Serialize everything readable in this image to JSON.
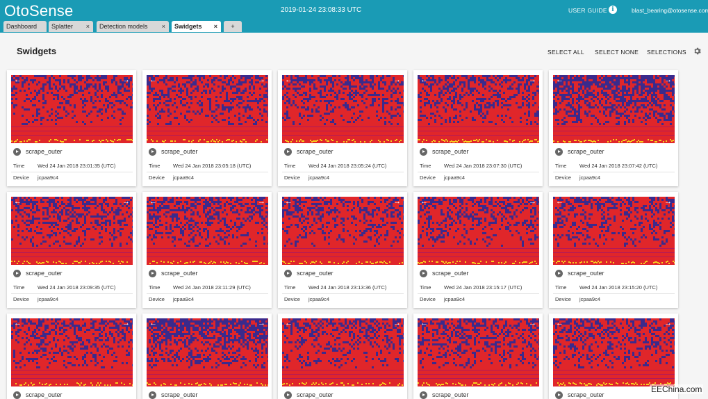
{
  "app": {
    "brand": "OtoSense",
    "clock": "2019-01-24 23:08:33 UTC",
    "user_guide": "USER GUIDE",
    "info_glyph": "i",
    "user_email": "blast_bearing@otosense.com"
  },
  "tabs": [
    {
      "label": "Dashboard",
      "closable": false
    },
    {
      "label": "Splatter",
      "closable": true
    },
    {
      "label": "Detection models",
      "closable": true
    },
    {
      "label": "Swidgets",
      "closable": true,
      "active": true
    },
    {
      "label": "+",
      "closable": false
    }
  ],
  "tab_close_glyph": "×",
  "toolbar": {
    "title": "Swidgets",
    "select_all": "SELECT ALL",
    "select_none": "SELECT NONE",
    "selections": "SELECTIONS",
    "settings_icon": "gear-icon"
  },
  "card_labels": {
    "time": "Time",
    "device": "Device",
    "prev_glyph": "←",
    "next_glyph": "→"
  },
  "cards": [
    {
      "name": "scrape_outer",
      "time": "Wed 24 Jan 2018 23:01:35 (UTC)",
      "device": "jcpaa9c4"
    },
    {
      "name": "scrape_outer",
      "time": "Wed 24 Jan 2018 23:05:18 (UTC)",
      "device": "jcpaa9c4"
    },
    {
      "name": "scrape_outer",
      "time": "Wed 24 Jan 2018 23:05:24 (UTC)",
      "device": "jcpaa9c4"
    },
    {
      "name": "scrape_outer",
      "time": "Wed 24 Jan 2018 23:07:30 (UTC)",
      "device": "jcpaa9c4"
    },
    {
      "name": "scrape_outer",
      "time": "Wed 24 Jan 2018 23:07:42 (UTC)",
      "device": "jcpaa9c4"
    },
    {
      "name": "scrape_outer",
      "time": "Wed 24 Jan 2018 23:09:35 (UTC)",
      "device": "jcpaa9c4"
    },
    {
      "name": "scrape_outer",
      "time": "Wed 24 Jan 2018 23:11:29 (UTC)",
      "device": "jcpaa9c4"
    },
    {
      "name": "scrape_outer",
      "time": "Wed 24 Jan 2018 23:13:36 (UTC)",
      "device": "jcpaa9c4"
    },
    {
      "name": "scrape_outer",
      "time": "Wed 24 Jan 2018 23:15:17 (UTC)",
      "device": "jcpaa9c4"
    },
    {
      "name": "scrape_outer",
      "time": "Wed 24 Jan 2018 23:15:20 (UTC)",
      "device": "jcpaa9c4"
    },
    {
      "name": "scrape_outer",
      "time": "",
      "device": ""
    },
    {
      "name": "scrape_outer",
      "time": "",
      "device": ""
    },
    {
      "name": "scrape_outer",
      "time": "",
      "device": ""
    },
    {
      "name": "scrape_outer",
      "time": "",
      "device": ""
    },
    {
      "name": "scrape_outer",
      "time": "",
      "device": ""
    }
  ],
  "colors": {
    "header": "#1a9bb5",
    "spec_red": "#e0262a",
    "spec_blue": "#3b2a8c",
    "spec_yellow": "#f7d21e"
  },
  "watermark": "EEChina.com"
}
